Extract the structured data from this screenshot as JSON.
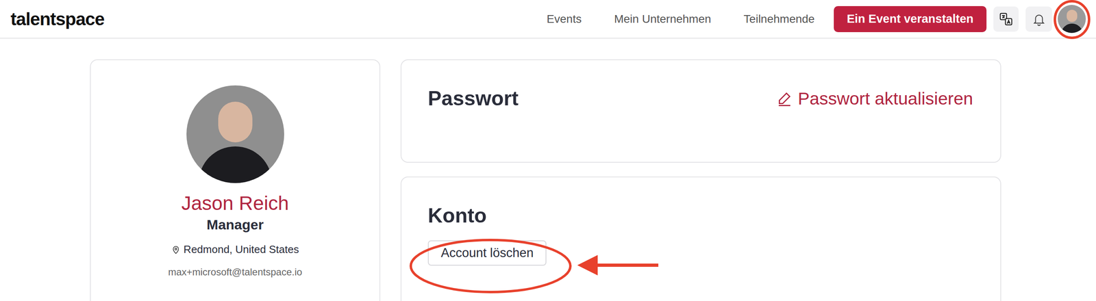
{
  "header": {
    "logo": "talentspace",
    "nav": [
      {
        "label": "Events"
      },
      {
        "label": "Mein Unternehmen"
      },
      {
        "label": "Teilnehmende"
      }
    ],
    "cta": "Ein Event veranstalten"
  },
  "profile": {
    "name": "Jason Reich",
    "role": "Manager",
    "location": "Redmond, United States",
    "email": "max+microsoft@talentspace.io"
  },
  "password_card": {
    "title": "Passwort",
    "action": "Passwort aktualisieren"
  },
  "account_card": {
    "title": "Konto",
    "button": "Account löschen"
  }
}
